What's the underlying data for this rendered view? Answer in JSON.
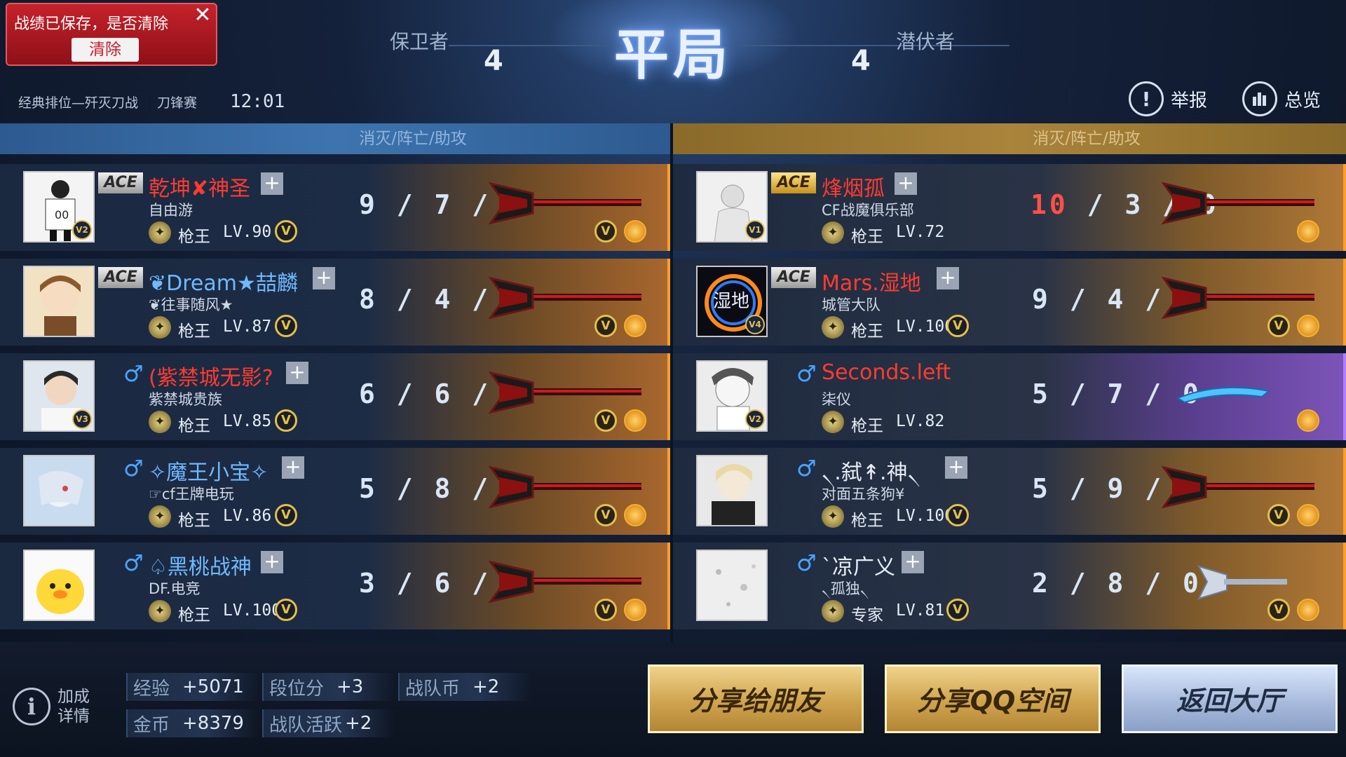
{
  "toast": {
    "message": "战绩已保存，是否清除",
    "close_label": "✕",
    "clear_label": "清除"
  },
  "match": {
    "mode": "经典排位—歼灭刀战",
    "sub_mode": "刀锋赛",
    "timer": "12:01",
    "result": "平局",
    "left_team": {
      "name": "保卫者",
      "score": "4"
    },
    "right_team": {
      "name": "潜伏者",
      "score": "4"
    }
  },
  "actions": {
    "report": "举报",
    "overview": "总览"
  },
  "headers": {
    "left": "消灭/阵亡/助攻",
    "right": "消灭/阵亡/助攻"
  },
  "left_players": [
    {
      "name": "乾坤✘神圣",
      "ace": "ACE",
      "clan": "自由游",
      "rank": "枪王",
      "level": "LV.90",
      "kda": "9 / 7 / 0",
      "vip": "V2"
    },
    {
      "name": "❦Dream★喆麟",
      "ace": "ACE",
      "clan": "❦往事随风★",
      "rank": "枪王",
      "level": "LV.87",
      "kda": "8 / 4 / 0",
      "vip": ""
    },
    {
      "name": "(紫禁城无影?",
      "gender": "♂",
      "clan": "紫禁城贵族",
      "rank": "枪王",
      "level": "LV.85",
      "kda": "6 / 6 / 0",
      "vip": "V3"
    },
    {
      "name": "✧魔王小宝✧",
      "gender": "♂",
      "clan": "☞cf王牌电玩",
      "rank": "枪王",
      "level": "LV.86",
      "kda": "5 / 8 / 0",
      "vip": ""
    },
    {
      "name": "♤黑桃战神",
      "gender": "♂",
      "clan": "DF.电竞",
      "rank": "枪王",
      "level": "LV.100",
      "kda": "3 / 6 / 0",
      "vip": ""
    }
  ],
  "right_players": [
    {
      "name": "烽烟孤",
      "ace": "ACE",
      "clan": "CF战魔俱乐部",
      "rank": "枪王",
      "level": "LV.72",
      "kda_top": "10",
      "kda_rest": " / 3 / 0",
      "vip": "V1"
    },
    {
      "name": "Mars.湿地",
      "ace": "ACE",
      "clan": "城管大队",
      "rank": "枪王",
      "level": "LV.100",
      "kda": "9 / 4 / 0",
      "vip": "V4",
      "avatar_text": "湿地"
    },
    {
      "name": "Seconds.left",
      "gender": "♂",
      "clan": "柒仪",
      "rank": "枪王",
      "level": "LV.82",
      "kda": "5 / 7 / 0",
      "vip": "V2"
    },
    {
      "name": "৲.弑↟.神৲",
      "gender": "♂",
      "clan": "对面五条狗¥",
      "rank": "枪王",
      "level": "LV.100",
      "kda": "5 / 9 / 0",
      "vip": ""
    },
    {
      "name": "`凉广义",
      "gender": "♂",
      "clan": "৲孤独৲",
      "rank": "专家",
      "level": "LV.81",
      "kda": "2 / 8 / 0",
      "vip": ""
    }
  ],
  "rewards": {
    "exp_label": "经验",
    "exp_value": "+5071",
    "rank_label": "段位分",
    "rank_value": "+3",
    "team_coin_label": "战队币",
    "team_coin_value": "+2",
    "gold_label": "金币",
    "gold_value": "+8379",
    "team_active_label": "战队活跃",
    "team_active_value": "+2",
    "info_label": "加成详情"
  },
  "buttons": {
    "share_friends": "分享给朋友",
    "share_qzone": "分享QQ空间",
    "back_lobby": "返回大厅"
  },
  "badges": {
    "v_mark": "V",
    "ace_label": "ACE"
  },
  "colors": {
    "left_accent": "#3e74ae",
    "right_accent": "#a9843b",
    "name_red": "#ff3b30",
    "highlight_border": "#ff9d2a"
  }
}
